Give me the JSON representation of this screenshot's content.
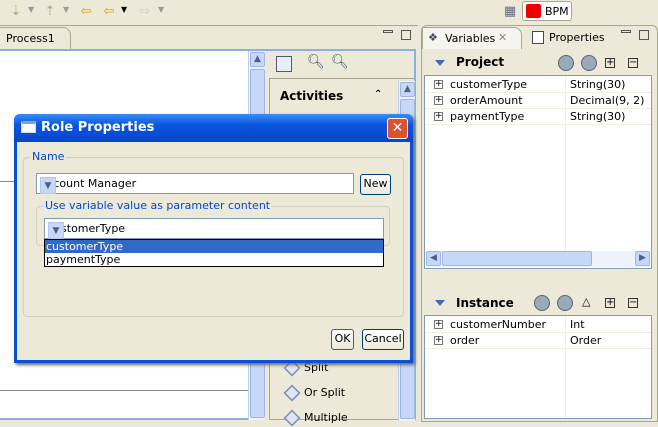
{
  "toolbar": {
    "perspective_label": "BPM"
  },
  "editor": {
    "tab_label": "Process1"
  },
  "palette": {
    "header": "Activities",
    "items": [
      "Split",
      "Or Split",
      "Multiple"
    ]
  },
  "variables_view": {
    "tabs": [
      "Variables",
      "Properties"
    ],
    "project": {
      "title": "Project",
      "rows": [
        {
          "name": "customerType",
          "type": "String(30)"
        },
        {
          "name": "orderAmount",
          "type": "Decimal(9, 2)"
        },
        {
          "name": "paymentType",
          "type": "String(30)"
        }
      ]
    },
    "instance": {
      "title": "Instance",
      "rows": [
        {
          "name": "customerNumber",
          "type": "Int"
        },
        {
          "name": "order",
          "type": "Order"
        }
      ]
    }
  },
  "dialog": {
    "title": "Role Properties",
    "name_group": "Name",
    "name_value": "Account Manager",
    "new_label": "New",
    "variable_group": "Use variable value as parameter content",
    "variable_value": "customerType",
    "options": [
      "customerType",
      "paymentType"
    ],
    "ok_label": "OK",
    "cancel_label": "Cancel"
  }
}
